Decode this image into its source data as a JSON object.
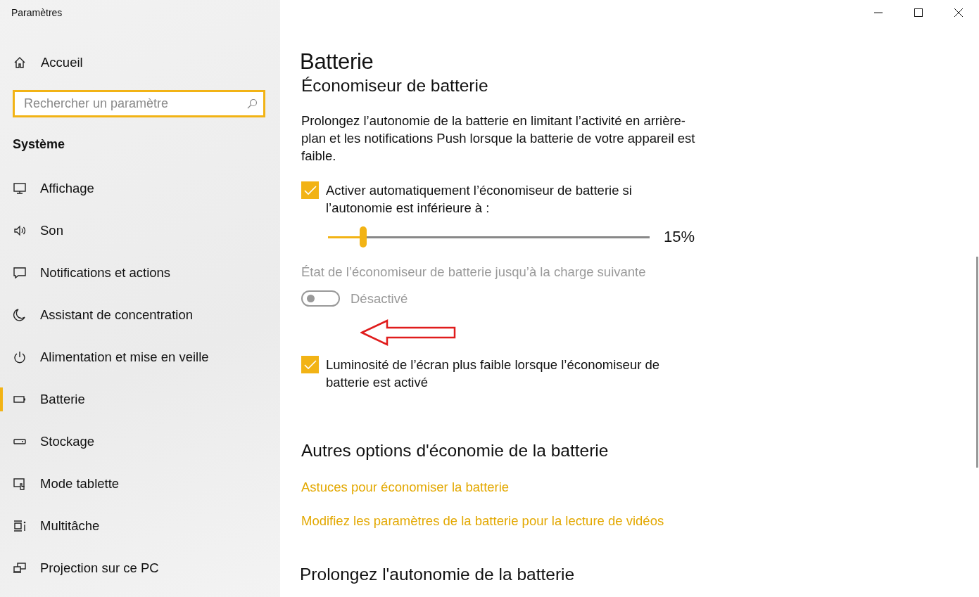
{
  "window": {
    "title": "Paramètres"
  },
  "sidebar": {
    "home": "Accueil",
    "search": {
      "placeholder": "Rechercher un paramètre"
    },
    "section": "Système",
    "items": [
      {
        "label": "Affichage",
        "selected": false
      },
      {
        "label": "Son",
        "selected": false
      },
      {
        "label": "Notifications et actions",
        "selected": false
      },
      {
        "label": "Assistant de concentration",
        "selected": false
      },
      {
        "label": "Alimentation et mise en veille",
        "selected": false
      },
      {
        "label": "Batterie",
        "selected": true
      },
      {
        "label": "Stockage",
        "selected": false
      },
      {
        "label": "Mode tablette",
        "selected": false
      },
      {
        "label": "Multitâche",
        "selected": false
      },
      {
        "label": "Projection sur ce PC",
        "selected": false
      }
    ]
  },
  "page": {
    "title": "Batterie",
    "section_title": "Économiseur de batterie",
    "description": "Prolongez l’autonomie de la batterie en limitant l’activité en arrière-plan et les notifications Push lorsque la batterie de votre appareil est faible.",
    "auto_saver": {
      "label": "Activer automatiquement l’économiseur de batterie si l’autonomie est inférieure à :",
      "checked": true
    },
    "threshold": {
      "level": 0.11,
      "reading": "15%"
    },
    "status": {
      "label": "État de l’économiseur de batterie jusqu’à la charge suivante",
      "on": false,
      "disabled": true,
      "state_text": "Désactivé"
    },
    "dim_screen": {
      "label": "Luminosité de l’écran plus faible lorsque l’économiseur de batterie est activé",
      "checked": true
    },
    "more_title": "Autres options d'économie de la batterie",
    "links": [
      "Astuces pour économiser la batterie",
      "Modifiez les paramètres de la batterie pour la lecture de vidéos"
    ],
    "extend_title": "Prolongez l'autonomie de la batterie"
  }
}
